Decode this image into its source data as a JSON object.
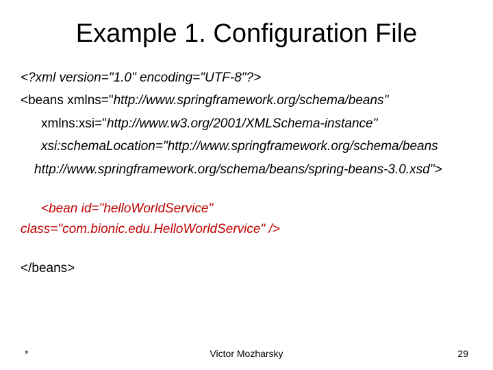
{
  "title": "Example 1. Configuration File",
  "lines": {
    "xml_decl": "<?xml version=\"1.0\" encoding=\"UTF-8\"?>",
    "beans_open_prefix": "<beans xmlns=\"",
    "beans_ns": "http://www.springframework.org/schema/beans",
    "quote_close": "\"",
    "xsi_prefix": "xmlns:xsi=\"",
    "xsi_ns": "http://www.w3.org/2001/XMLSchema-instance",
    "schema_loc": "xsi:schemaLocation=\"http://www.springframework.org/schema/beans",
    "schema_xsd": "http://www.springframework.org/schema/beans/spring-beans-3.0.xsd",
    "close_tag": "\">",
    "bean_line1": "<bean id=\"helloWorldService\"",
    "bean_line2": "class=\"com.bionic.edu.HelloWorldService\" />",
    "beans_close": "</beans>"
  },
  "footer": {
    "left": "*",
    "center": "Victor Mozharsky",
    "right": "29"
  }
}
